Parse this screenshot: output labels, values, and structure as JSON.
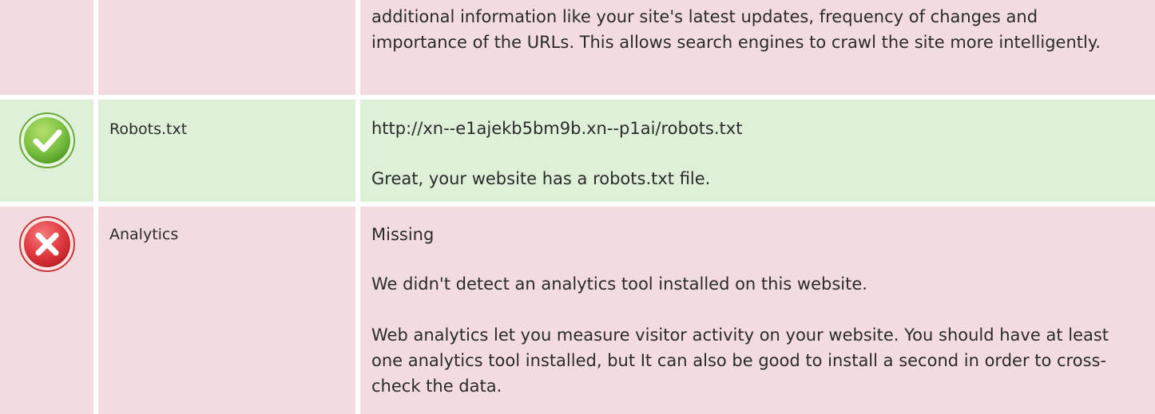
{
  "rows": [
    {
      "status": "warning",
      "label": "",
      "paragraphs": [
        "additional information like your site's latest updates, frequency of changes and importance of the URLs. This allows search engines to crawl the site more intelligently."
      ]
    },
    {
      "status": "pass",
      "icon": "check-circle-icon",
      "label": "Robots.txt",
      "paragraphs": [
        "http://xn--e1ajekb5bm9b.xn--p1ai/robots.txt",
        "Great, your website has a robots.txt file."
      ]
    },
    {
      "status": "fail",
      "icon": "x-circle-icon",
      "label": "Analytics",
      "paragraphs": [
        "Missing",
        "We didn't detect an analytics tool installed on this website.",
        "Web analytics let you measure visitor activity on your website. You should have at least one analytics tool installed, but It can also be good to install a second in order to cross-check the data."
      ]
    }
  ],
  "colors": {
    "warning_bg": "#f2dcdf",
    "pass_bg": "#dff0d8",
    "fail_bg": "#f2dcdf",
    "pass_icon": "#7cc242",
    "fail_icon": "#e0393e"
  }
}
